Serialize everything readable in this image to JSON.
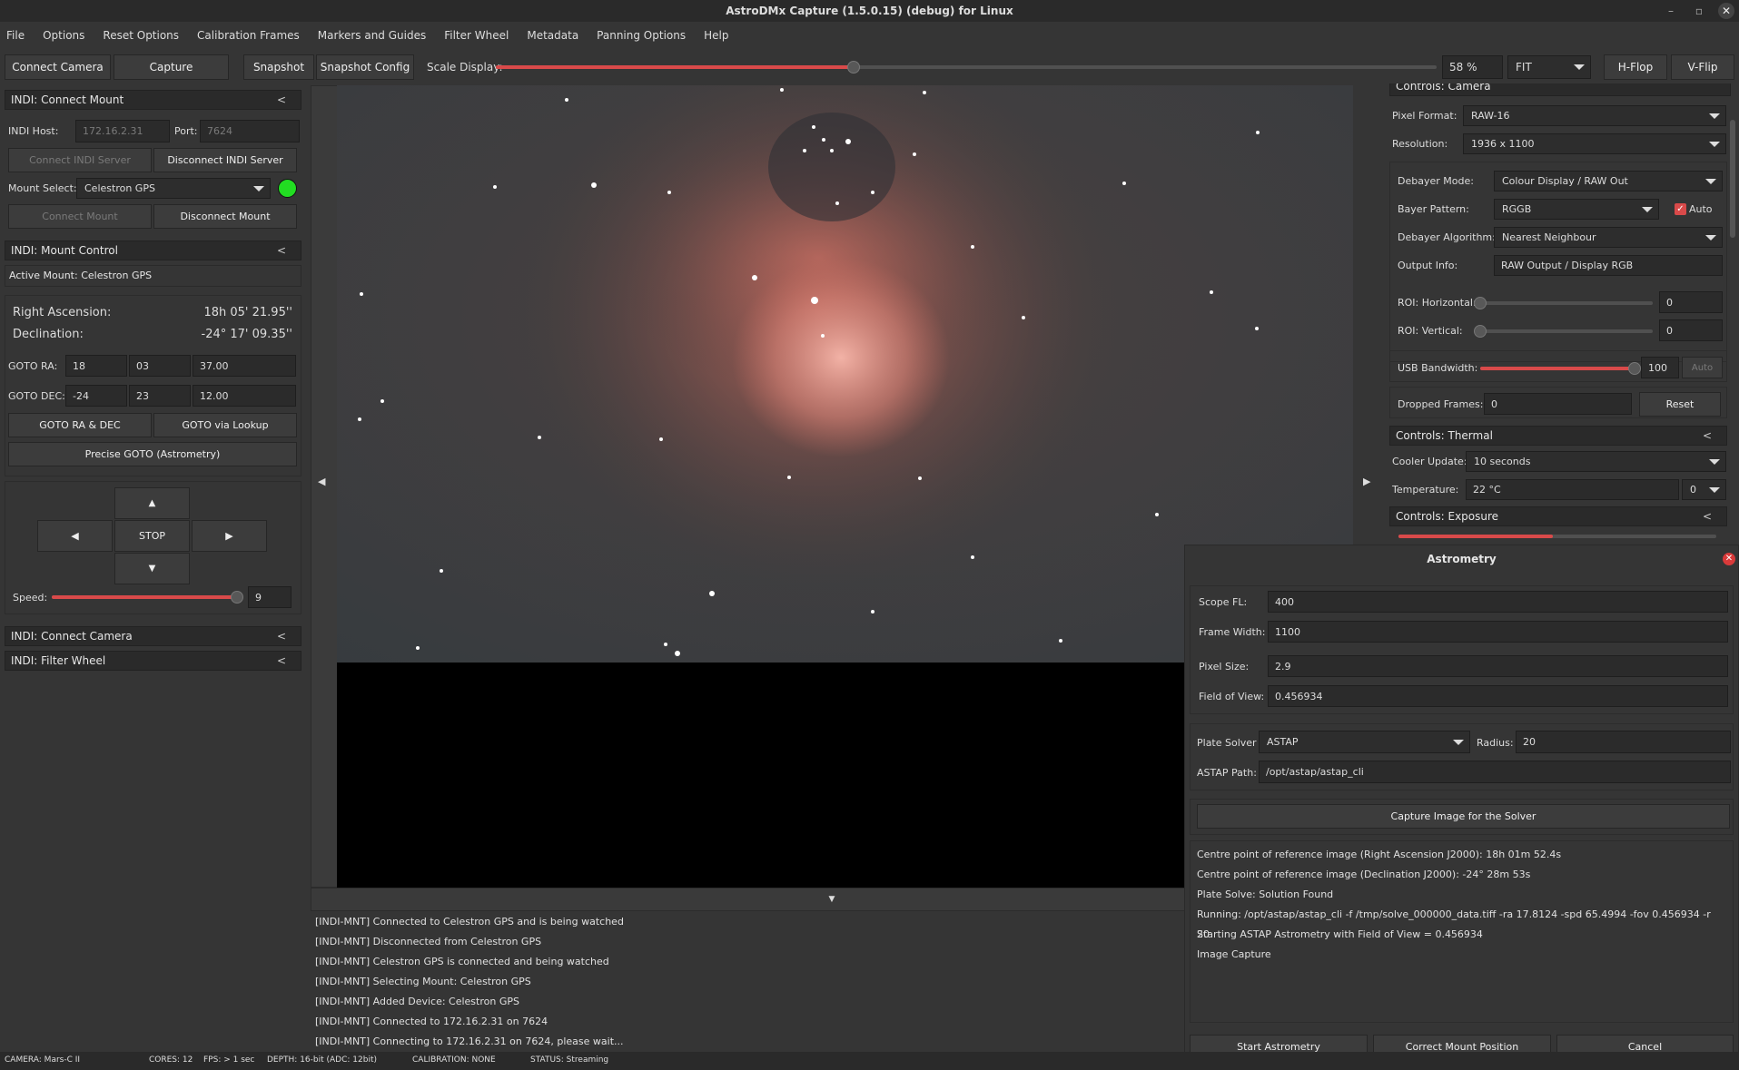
{
  "window": {
    "title": "AstroDMx Capture (1.5.0.15) (debug) for Linux"
  },
  "menu": [
    "File",
    "Options",
    "Reset Options",
    "Calibration Frames",
    "Markers and Guides",
    "Filter Wheel",
    "Metadata",
    "Panning Options",
    "Help"
  ],
  "toolbar": {
    "connect_camera": "Connect Camera",
    "capture": "Capture",
    "snapshot": "Snapshot",
    "snapshot_config": "Snapshot Config",
    "scale_label": "Scale Display:",
    "scale_value": 0.38,
    "zoom": "58 %",
    "fit": "FIT",
    "hflop": "H-Flop",
    "vflip": "V-Flip"
  },
  "connect_mount": {
    "header": "INDI: Connect Mount",
    "collapse": "<",
    "host_label": "INDI Host:",
    "host_value": "172.16.2.31",
    "port_label": "Port:",
    "port_value": "7624",
    "connect_server": "Connect INDI Server",
    "disconnect_server": "Disconnect INDI Server",
    "mount_select_label": "Mount Select:",
    "mount_select_value": "Celestron GPS",
    "status_color": "#22dd22",
    "connect_mount": "Connect Mount",
    "disconnect_mount": "Disconnect Mount"
  },
  "mount_control": {
    "header": "INDI: Mount Control",
    "collapse": "<",
    "active_mount": "Active Mount: Celestron GPS",
    "ra_label": "Right Ascension:",
    "ra_value": "18h 05' 21.95''",
    "dec_label": "Declination:",
    "dec_value": "-24° 17' 09.35''",
    "goto_ra_label": "GOTO RA:",
    "goto_ra": [
      "18",
      "03",
      "37.00"
    ],
    "goto_dec_label": "GOTO DEC:",
    "goto_dec": [
      "-24",
      "23",
      "12.00"
    ],
    "goto_radec": "GOTO RA & DEC",
    "goto_lookup": "GOTO via Lookup",
    "precise_goto": "Precise GOTO (Astrometry)",
    "up": "▲",
    "left": "◀",
    "stop": "STOP",
    "right": "▶",
    "down": "▼",
    "speed_label": "Speed:",
    "speed_value": "9",
    "speed_fraction": 1.0
  },
  "connect_camera_panel": {
    "header": "INDI: Connect Camera",
    "collapse": "<"
  },
  "filter_wheel_panel": {
    "header": "INDI: Filter Wheel",
    "collapse": "<"
  },
  "image": {
    "left_arrow": "◀",
    "right_arrow": "▶",
    "down_arrow": "▼"
  },
  "log": [
    "[INDI-MNT] Connected to Celestron GPS and is being watched",
    "[INDI-MNT] Disconnected from Celestron GPS",
    "[INDI-MNT] Celestron GPS is connected and being watched",
    "[INDI-MNT] Selecting Mount: Celestron GPS",
    "[INDI-MNT] Added Device: Celestron GPS",
    "[INDI-MNT] Connected to 172.16.2.31 on 7624",
    "[INDI-MNT] Connecting to 172.16.2.31 on 7624, please wait..."
  ],
  "camera_controls": {
    "header": "Controls: Camera",
    "pixel_format_label": "Pixel Format:",
    "pixel_format": "RAW-16",
    "resolution_label": "Resolution:",
    "resolution": "1936 x 1100",
    "debayer_mode_label": "Debayer Mode:",
    "debayer_mode": "Colour Display / RAW Out",
    "bayer_pattern_label": "Bayer Pattern:",
    "bayer_pattern": "RGGB",
    "auto_label": "Auto",
    "debayer_algo_label": "Debayer Algorithm:",
    "debayer_algo": "Nearest Neighbour",
    "output_info_label": "Output Info:",
    "output_info": "RAW Output / Display RGB",
    "roi_h_label": "ROI: Horizontal:",
    "roi_h": "0",
    "roi_v_label": "ROI: Vertical:",
    "roi_v": "0",
    "usb_label": "USB Bandwidth:",
    "usb_value": "100",
    "usb_fraction": 1.0,
    "usb_auto": "Auto",
    "dropped_label": "Dropped Frames:",
    "dropped_value": "0",
    "reset": "Reset"
  },
  "thermal": {
    "header": "Controls: Thermal",
    "collapse": "<",
    "cooler_label": "Cooler Update:",
    "cooler_value": "10 seconds",
    "temp_label": "Temperature:",
    "temp_value": "22 °C",
    "temp_combo": "0"
  },
  "exposure": {
    "header": "Controls: Exposure",
    "collapse": "<"
  },
  "astrometry": {
    "title": "Astrometry",
    "scope_fl_label": "Scope FL:",
    "scope_fl": "400",
    "frame_width_label": "Frame Width:",
    "frame_width": "1100",
    "pixel_size_label": "Pixel Size:",
    "pixel_size": "2.9",
    "fov_label": "Field of View:",
    "fov": "0.456934",
    "solver_label": "Plate Solver",
    "solver": "ASTAP",
    "radius_label": "Radius:",
    "radius": "20",
    "path_label": "ASTAP Path:",
    "path": "/opt/astap/astap_cli",
    "capture_btn": "Capture Image for the Solver",
    "output": [
      "Centre point of reference image (Right Ascension J2000): 18h 01m 52.4s",
      "Centre point of reference image (Declination J2000): -24° 28m 53s",
      "Plate Solve: Solution Found",
      "Running: /opt/astap/astap_cli -f /tmp/solve_000000_data.tiff -ra 17.8124 -spd 65.4994 -fov 0.456934 -r 20",
      "Starting ASTAP Astrometry with Field of View = 0.456934",
      "Image Capture"
    ],
    "start": "Start Astrometry",
    "correct": "Correct Mount Position",
    "cancel": "Cancel"
  },
  "status": {
    "camera": "CAMERA: Mars-C II",
    "cores": "CORES: 12",
    "fps": "FPS: > 1 sec",
    "depth": "DEPTH: 16-bit (ADC: 12bit)",
    "calibration": "CALIBRATION: NONE",
    "state": "STATUS: Streaming"
  }
}
